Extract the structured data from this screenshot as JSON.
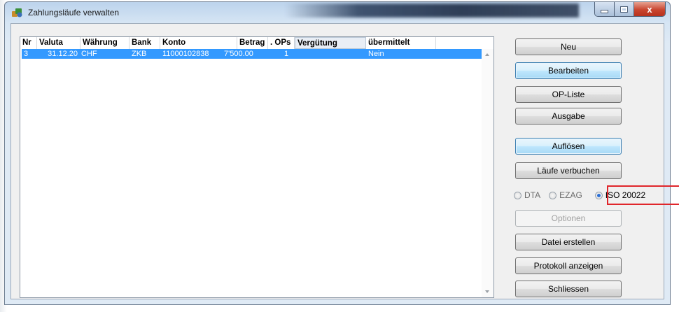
{
  "window": {
    "title": "Zahlungsläufe verwalten",
    "close_glyph": "x",
    "minimize_glyph": "—",
    "maximize_glyph": "□"
  },
  "table": {
    "columns": [
      "Nr",
      "Valuta",
      "Währung",
      "Bank",
      "Konto",
      "Betrag",
      ". OPs",
      "Vergütung",
      "übermittelt"
    ],
    "rows": [
      {
        "nr": "3",
        "valuta": "31.12.20",
        "waehrung": "CHF",
        "bank": "ZKB",
        "konto": "11000102838",
        "betrag": "7'500.00",
        "ops": "1",
        "verguetung": "",
        "uebermittelt": "Nein"
      }
    ],
    "selected_row_color": "#3399ff"
  },
  "buttons": {
    "neu": "Neu",
    "bearbeiten": "Bearbeiten",
    "op_liste": "OP-Liste",
    "ausgabe": "Ausgabe",
    "aufloesen": "Auflösen",
    "laeufe_verbuchen": "Läufe verbuchen",
    "optionen": "Optionen",
    "datei_erstellen": "Datei erstellen",
    "protokoll_anzeigen": "Protokoll anzeigen",
    "schliessen": "Schliessen"
  },
  "format": {
    "options": [
      "DTA",
      "EZAG",
      "ISO 20022"
    ],
    "selected": "ISO 20022",
    "highlight_color": "#e0262b"
  }
}
